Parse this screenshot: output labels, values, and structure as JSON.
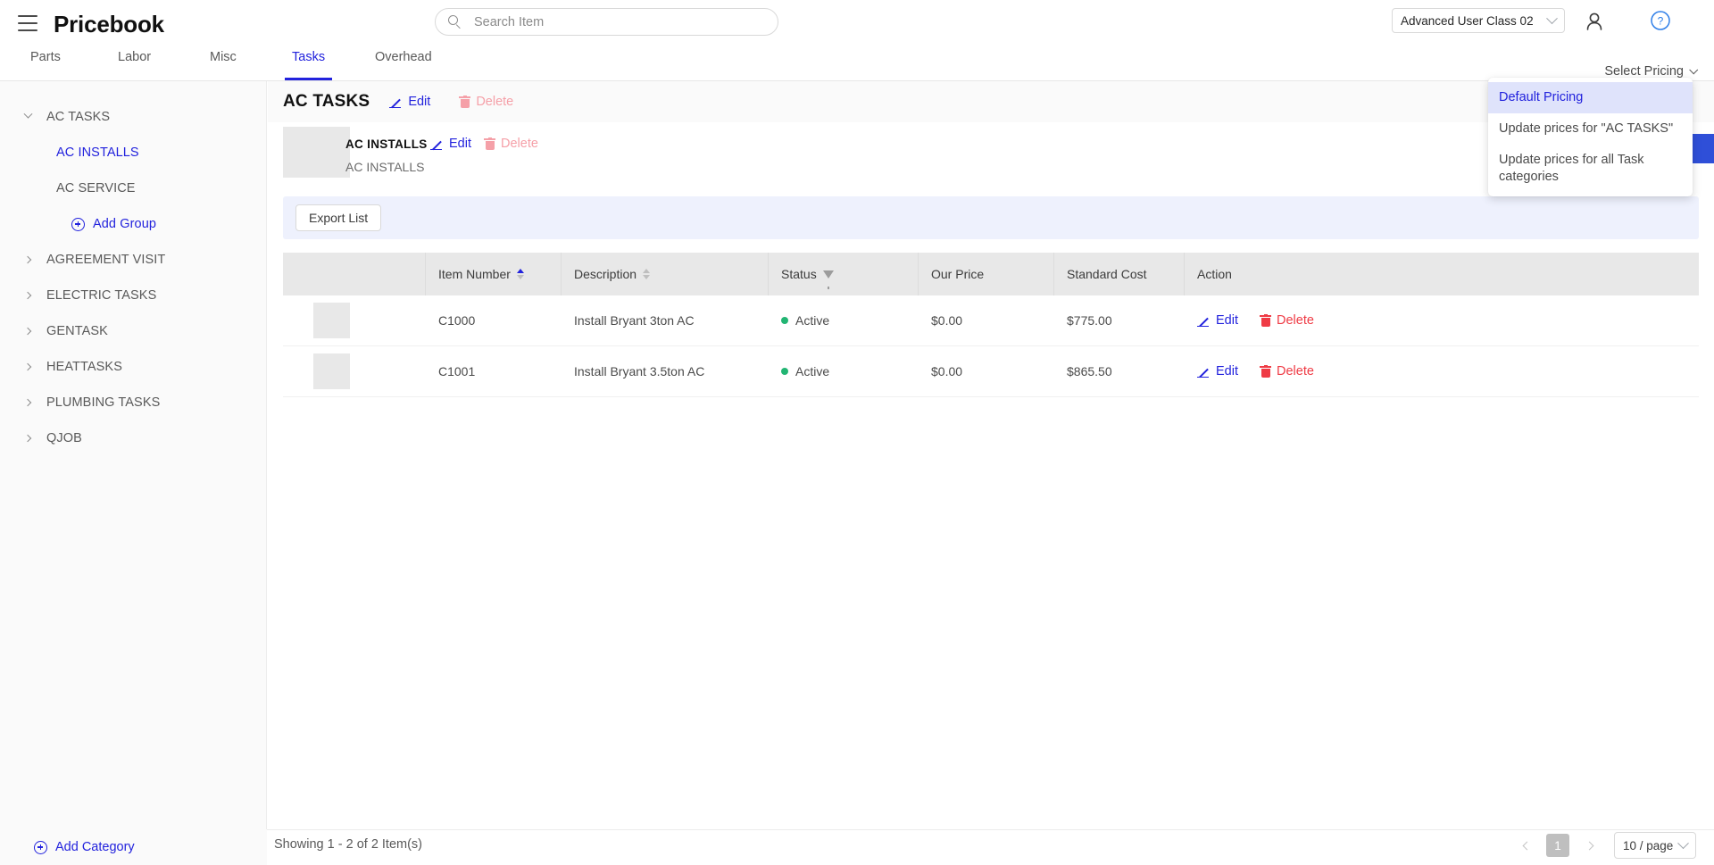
{
  "header": {
    "brand": "Pricebook",
    "menu_icon": "hamburger-icon",
    "search": {
      "placeholder": "Search Item",
      "value": "",
      "icon": "search-icon"
    },
    "user_class": "Advanced User Class 02",
    "account_icon": "user-icon",
    "help_icon": "question-circle-icon"
  },
  "tabs": [
    {
      "label": "Parts",
      "active": false
    },
    {
      "label": "Labor",
      "active": false
    },
    {
      "label": "Misc",
      "active": false
    },
    {
      "label": "Tasks",
      "active": true
    },
    {
      "label": "Overhead",
      "active": false
    }
  ],
  "select_pricing": {
    "label": "Select Pricing"
  },
  "pricing_menu": {
    "items": [
      {
        "label": "Default Pricing",
        "selected": true
      },
      {
        "label": "Update prices for \"AC TASKS\"",
        "selected": false
      },
      {
        "label": "Update prices for all Task categories",
        "selected": false
      }
    ]
  },
  "sidebar": {
    "items": [
      {
        "label": "AC TASKS",
        "type": "category",
        "expanded": true,
        "selected": false
      },
      {
        "label": "AC INSTALLS",
        "type": "group",
        "selected": true
      },
      {
        "label": "AC SERVICE",
        "type": "group",
        "selected": false
      },
      {
        "label": "Add Group",
        "type": "action"
      },
      {
        "label": "AGREEMENT VISIT",
        "type": "category",
        "expanded": false,
        "selected": false
      },
      {
        "label": "ELECTRIC TASKS",
        "type": "category",
        "expanded": false,
        "selected": false
      },
      {
        "label": "GENTASK",
        "type": "category",
        "expanded": false,
        "selected": false
      },
      {
        "label": "HEATTASKS",
        "type": "category",
        "expanded": false,
        "selected": false
      },
      {
        "label": "PLUMBING TASKS",
        "type": "category",
        "expanded": false,
        "selected": false
      },
      {
        "label": "QJOB",
        "type": "category",
        "expanded": false,
        "selected": false
      }
    ],
    "add_category": "Add Category"
  },
  "category_header": {
    "title": "AC TASKS",
    "edit_label": "Edit",
    "delete_label": "Delete"
  },
  "group_header": {
    "name": "AC INSTALLS",
    "description": "AC INSTALLS",
    "edit_label": "Edit",
    "delete_label": "Delete"
  },
  "toolbar": {
    "export_label": "Export List"
  },
  "table": {
    "columns": [
      {
        "label": "",
        "sort": "none"
      },
      {
        "label": "Item Number",
        "sort": "asc"
      },
      {
        "label": "Description",
        "sort": "none"
      },
      {
        "label": "Status",
        "filter": true
      },
      {
        "label": "Our Price"
      },
      {
        "label": "Standard Cost"
      },
      {
        "label": "Action"
      }
    ],
    "rows": [
      {
        "item_number": "C1000",
        "description": "Install Bryant 3ton AC",
        "status": "Active",
        "our_price": "$0.00",
        "standard_cost": "$775.00",
        "edit_label": "Edit",
        "delete_label": "Delete"
      },
      {
        "item_number": "C1001",
        "description": "Install Bryant 3.5ton AC",
        "status": "Active",
        "our_price": "$0.00",
        "standard_cost": "$865.50",
        "edit_label": "Edit",
        "delete_label": "Delete"
      }
    ]
  },
  "footer": {
    "showing": "Showing 1 - 2 of 2 Item(s)",
    "page_number": "1",
    "page_size": "10 / page"
  },
  "colors": {
    "accent": "#2222dd",
    "primary_button": "#2f4fd8",
    "danger": "#ef3b45",
    "danger_muted": "#f5a0a8",
    "status_active": "#22b573",
    "toolbar_bg": "#eef1fd",
    "menu_selected_bg": "#dfe3fb"
  }
}
